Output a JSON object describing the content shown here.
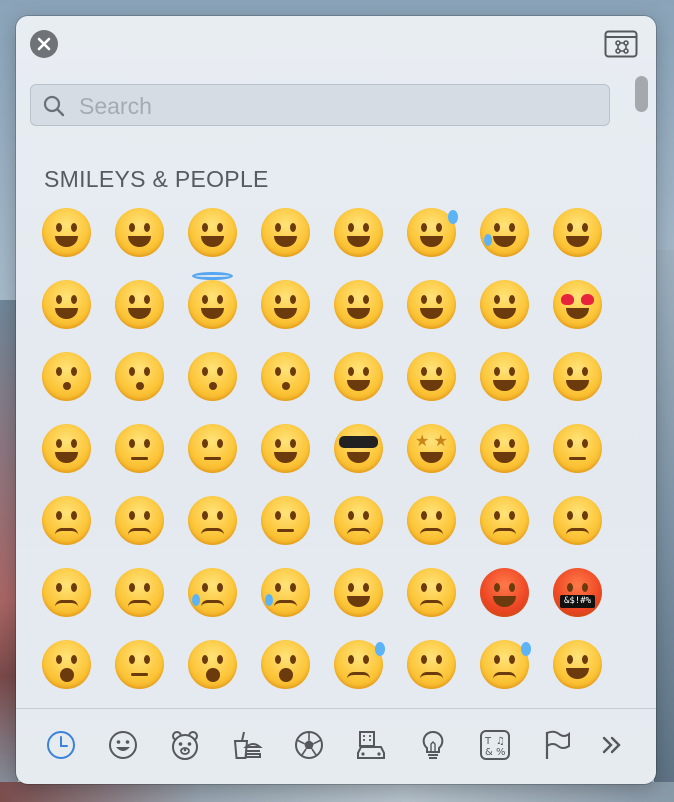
{
  "window": {
    "close_icon": "close-icon",
    "viewer_icon": "character-viewer-icon"
  },
  "search": {
    "placeholder": "Search",
    "value": ""
  },
  "section": {
    "title": "SMILEYS & PEOPLE"
  },
  "emoji_rows": [
    [
      "grinning-face",
      "grinning-face-big-eyes",
      "grinning-face-smiling-eyes",
      "beaming-face",
      "grinning-squinting-face",
      "grinning-face-with-sweat",
      "face-with-tears-of-joy",
      "rolling-on-floor-laughing"
    ],
    [
      "smiling-face",
      "smiling-face-smiling-eyes",
      "smiling-face-with-halo",
      "slightly-smiling-face",
      "upside-down-face",
      "winking-face",
      "relieved-face",
      "smiling-face-heart-eyes"
    ],
    [
      "face-blowing-kiss",
      "kissing-face",
      "kissing-face-smiling-eyes",
      "kissing-face-closed-eyes",
      "face-savoring-food",
      "face-with-tongue",
      "squinting-face-with-tongue",
      "winking-face-with-tongue"
    ],
    [
      "zany-face",
      "face-raised-eyebrow",
      "face-with-monocle",
      "nerd-face",
      "smiling-face-sunglasses",
      "star-struck",
      "smirking-face",
      "unamused-face"
    ],
    [
      "disappointed-face",
      "pensive-face",
      "worried-face",
      "confused-face",
      "slightly-frowning-face",
      "frowning-face",
      "persevering-face",
      "confounded-face"
    ],
    [
      "tired-face",
      "weary-face",
      "crying-face",
      "loudly-crying-face",
      "face-steam-from-nose",
      "angry-face",
      "pouting-face",
      "face-symbols-on-mouth"
    ],
    [
      "exploding-head",
      "flushed-face",
      "face-screaming-in-fear",
      "fearful-face",
      "anxious-face-with-sweat",
      "sad-but-relieved-face",
      "downcast-face-with-sweat",
      "hugging-face"
    ]
  ],
  "symbols_text": "&$!#%",
  "categories": [
    {
      "name": "frequently-used",
      "icon": "clock-icon",
      "active": true
    },
    {
      "name": "smileys-people",
      "icon": "smiley-icon",
      "active": false
    },
    {
      "name": "animals-nature",
      "icon": "bear-icon",
      "active": false
    },
    {
      "name": "food-drink",
      "icon": "food-icon",
      "active": false
    },
    {
      "name": "activity",
      "icon": "soccer-ball-icon",
      "active": false
    },
    {
      "name": "travel-places",
      "icon": "building-car-icon",
      "active": false
    },
    {
      "name": "objects",
      "icon": "lightbulb-icon",
      "active": false
    },
    {
      "name": "symbols",
      "icon": "symbols-icon",
      "active": false
    },
    {
      "name": "flags",
      "icon": "flag-icon",
      "active": false
    },
    {
      "name": "more",
      "icon": "chevron-right-double-icon",
      "active": false
    }
  ],
  "colors": {
    "accent": "#3b82d9",
    "icon_gray": "#55595e",
    "emoji_yellow": "#fcc63a"
  }
}
